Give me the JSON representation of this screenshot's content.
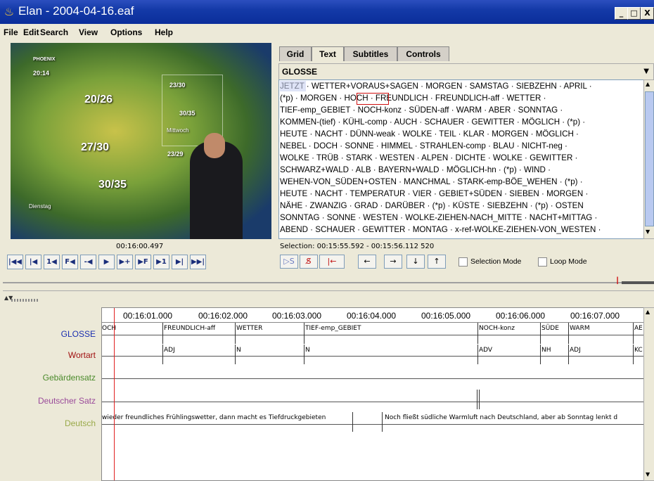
{
  "window": {
    "title": "Elan - 2004-04-16.eaf",
    "minimize": "_",
    "maximize": "□",
    "close": "X"
  },
  "menu": [
    "File",
    "Edit",
    "Search",
    "View",
    "Options",
    "Help"
  ],
  "video": {
    "channel": "PHOENIX",
    "clock": "20:14",
    "temps": [
      "20/26",
      "23/30",
      "30/35",
      "27/30",
      "23/29",
      "30/35"
    ],
    "day1": "Mittwoch",
    "day2": "Dienstag"
  },
  "player": {
    "time": "00:16:00.497",
    "buttons": [
      "|◀◀",
      "|◀",
      "1◀",
      "F◀",
      "-◀",
      "▶",
      "▶+",
      "▶F",
      "▶1",
      "▶|",
      "▶▶|"
    ]
  },
  "tabs": [
    "Grid",
    "Text",
    "Subtitles",
    "Controls"
  ],
  "tier_select": "GLOSSE",
  "text_lines": [
    "JETZT · WETTER+VORAUS+SAGEN · MORGEN · SAMSTAG · SIEBZEHN · APRIL ·",
    "(*p) · MORGEN · HOCH · FREUNDLICH · FREUNDLICH-aff · WETTER ·",
    "TIEF-emp_GEBIET · NOCH-konz · SÜDEN-aff · WARM · ABER · SONNTAG ·",
    "KOMMEN-(tief) · KÜHL-comp · AUCH · SCHAUER · GEWITTER · MÖGLICH · (*p) ·",
    "HEUTE · NACHT · DÜNN-weak · WOLKE · TEIL · KLAR · MORGEN · MÖGLICH ·",
    "NEBEL · DOCH · SONNE · HIMMEL · STRAHLEN-comp · BLAU · NICHT-neg ·",
    "WOLKE · TRÜB · STARK · WESTEN · ALPEN · DICHTE · WOLKE · GEWITTER ·",
    "SCHWARZ+WALD · ALB · BAYERN+WALD · MÖGLICH-hn · (*p) · WIND ·",
    "WEHEN-VON_SÜDEN+OSTEN · MANCHMAL · STARK-emp-BÖE_WEHEN · (*p) ·",
    "HEUTE · NACHT · TEMPERATUR · VIER · GEBIET+SÜDEN · SIEBEN · MORGEN ·",
    "NÄHE · ZWANZIG · GRAD · DARÜBER · (*p) · KÜSTE · SIEBZEHN · (*p) · OSTEN",
    "SONNTAG · SONNE · WESTEN · WOLKE-ZIEHEN-NACH_MITTE · NACHT+MITTAG ·",
    "ABEND · SCHAUER · GEWITTER · MONTAG · x-ref-WOLKE-ZIEHEN-VON_WESTEN ·"
  ],
  "selection": "Selection: 00:15:55.592 - 00:15:56.112  520",
  "controls": {
    "s_left": "▷S",
    "s_clear": "S̸",
    "to_begin": "|←",
    "left": "←",
    "right": "→",
    "down": "↓",
    "up": "↑",
    "selection_mode": "Selection Mode",
    "loop_mode": "Loop Mode"
  },
  "ruler": [
    "00:16:01.000",
    "00:16:02.000",
    "00:16:03.000",
    "00:16:04.000",
    "00:16:05.000",
    "00:16:06.000",
    "00:16:07.000"
  ],
  "tiers": [
    {
      "name": "GLOSSE",
      "color": "#1a2eb0"
    },
    {
      "name": "Wortart",
      "color": "#a01010"
    },
    {
      "name": "Gebärdensatz",
      "color": "#4a8a2a"
    },
    {
      "name": "Deutscher Satz",
      "color": "#9a4a9a"
    },
    {
      "name": "Deutsch",
      "color": "#9aaa4a"
    }
  ],
  "glosse": [
    "OCH",
    "FREUNDLICH-aff",
    "WETTER",
    "TIEF-emp_GEBIET",
    "NOCH-konz",
    "SÜDE",
    "WARM",
    "AE"
  ],
  "wortart": [
    "ADJ",
    "N",
    "N",
    "ADV",
    "NH",
    "ADJ",
    "KC"
  ],
  "deutsch": [
    "wieder freundliches Frühlingswetter, dann macht es Tiefdruckgebieten",
    "Noch fließt südliche Warmluft nach Deutschland, aber ab Sonntag lenkt d"
  ]
}
